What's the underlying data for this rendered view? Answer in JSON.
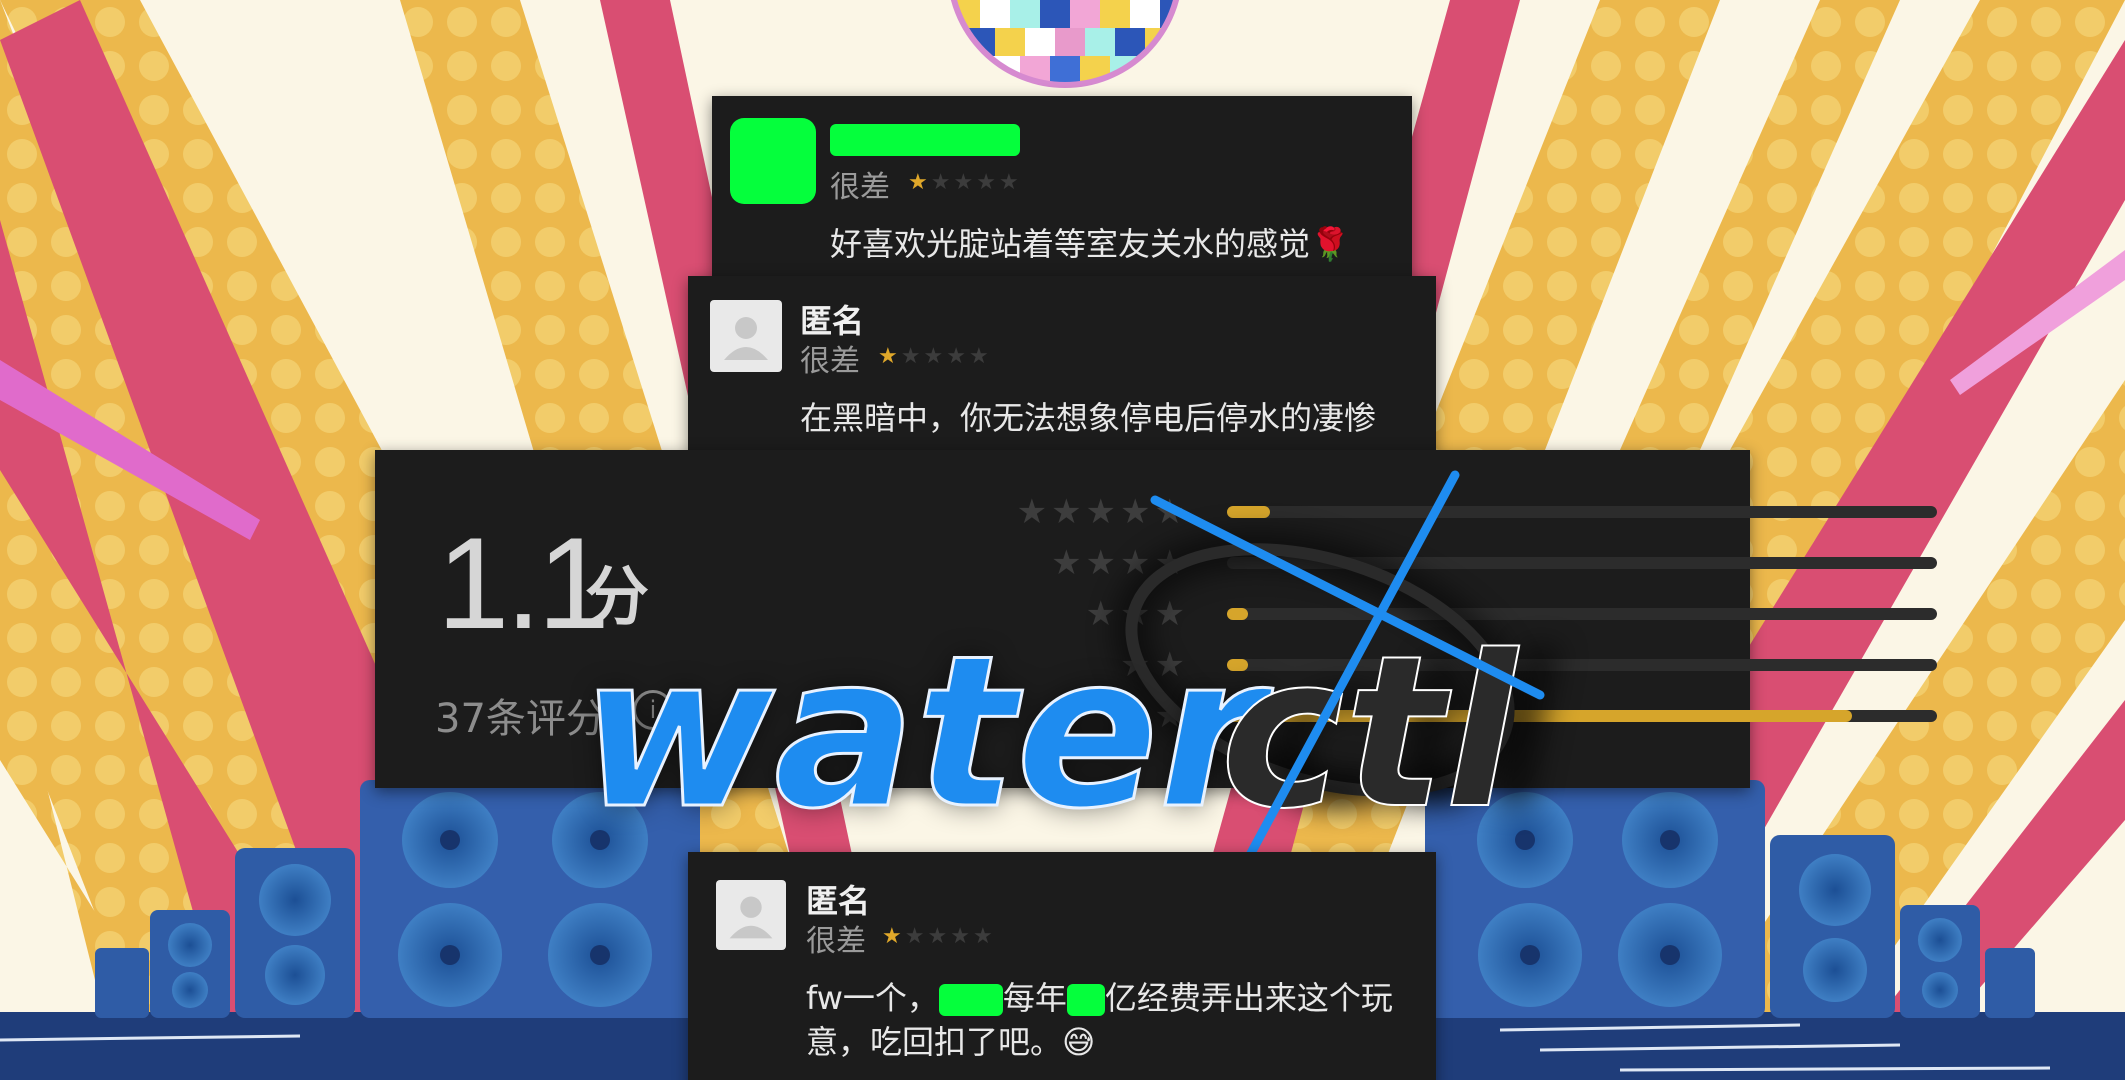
{
  "reviews": [
    {
      "name": "",
      "name_redacted": true,
      "avatar": "green-redacted",
      "rating_text": "很差",
      "stars": 1,
      "stars_total": 5,
      "comment": "好喜欢光腚站着等室友关水的感觉",
      "emoji": "🌹"
    },
    {
      "name": "匿名",
      "avatar": "anonymous-user-icon",
      "rating_text": "很差",
      "stars": 1,
      "stars_total": 5,
      "comment": "在黑暗中，你无法想象停电后停水的凄惨"
    },
    {
      "name": "匿名",
      "avatar": "anonymous-user-icon",
      "rating_text": "很差",
      "stars": 1,
      "stars_total": 5,
      "comment_line1_a": "fw一个，",
      "comment_line1_b": "每年",
      "comment_line1_c": "亿经费弄出来这个玩",
      "comment_line2": "意，吃回扣了吧。",
      "emoji": "😅"
    }
  ],
  "summary": {
    "score": "1.1",
    "unit": "分",
    "count_text": "37条评分",
    "info_icon": "info-icon",
    "distribution": [
      {
        "stars": 5,
        "fraction": 0.06
      },
      {
        "stars": 4,
        "fraction": 0.0
      },
      {
        "stars": 3,
        "fraction": 0.03
      },
      {
        "stars": 2,
        "fraction": 0.03
      },
      {
        "stars": 1,
        "fraction": 0.88
      }
    ]
  },
  "logo": {
    "text": "waterctl",
    "colors": {
      "water": "#1e8cf0",
      "ctl": "#2a2a2a"
    }
  },
  "colors": {
    "accent_green": "#05ff3c",
    "star_gold": "#e0a82a",
    "card_bg": "#1c1c1c"
  }
}
